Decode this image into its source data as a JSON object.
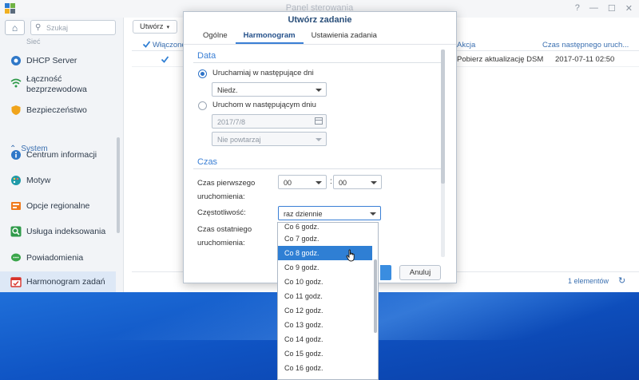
{
  "window": {
    "title": "Panel sterowania",
    "controls": [
      "?",
      "—",
      "☐",
      "✕"
    ]
  },
  "sidebar": {
    "search_placeholder": "Szukaj",
    "cut_item": "Sieć",
    "items": [
      {
        "label": "DHCP Server"
      },
      {
        "label": "Łączność bezprzewodowa"
      },
      {
        "label": "Bezpieczeństwo"
      }
    ],
    "section": "System",
    "system_items": [
      {
        "label": "Centrum informacji"
      },
      {
        "label": "Motyw"
      },
      {
        "label": "Opcje regionalne"
      },
      {
        "label": "Usługa indeksowania"
      },
      {
        "label": "Powiadomienia"
      },
      {
        "label": "Harmonogram zadań"
      }
    ]
  },
  "content": {
    "create_label": "Utwórz",
    "columns": {
      "enabled": "Włączone",
      "action": "Akcja",
      "next_run": "Czas następnego uruch..."
    },
    "rows": [
      {
        "action": "Pobierz aktualizację DSM",
        "next_run": "2017-07-11 02:50"
      }
    ],
    "footer_count": "1 elementów"
  },
  "dialog": {
    "title": "Utwórz zadanie",
    "tabs": [
      "Ogólne",
      "Harmonogram",
      "Ustawienia zadania"
    ],
    "active_tab": "Harmonogram",
    "date_group": "Data",
    "radio_days": "Uruchamiaj w następujące dni",
    "days_value": "Niedz.",
    "radio_day": "Uruchom w następującym dniu",
    "date_value": "2017/7/8",
    "repeat_value": "Nie powtarzaj",
    "time_group": "Czas",
    "first_run_label_1": "Czas pierwszego",
    "first_run_label_2": "uruchomienia:",
    "hour_value": "00",
    "minute_value": "00",
    "frequency_label": "Częstotliwość:",
    "frequency_value": "raz dziennie",
    "last_run_label_1": "Czas ostatniego",
    "last_run_label_2": "uruchomienia:",
    "cancel_label": "Anuluj"
  },
  "dropdown": {
    "options": [
      "Co 6 godz.",
      "Co 7 godz.",
      "Co 8 godz.",
      "Co 9 godz.",
      "Co 10 godz.",
      "Co 11 godz.",
      "Co 12 godz.",
      "Co 13 godz.",
      "Co 14 godz.",
      "Co 15 godz.",
      "Co 16 godz."
    ],
    "selected": "Co 8 godz."
  },
  "colors": {
    "accent": "#3a7fd5",
    "selected": "#2f7fd4",
    "desktop": "#0f54c4"
  }
}
